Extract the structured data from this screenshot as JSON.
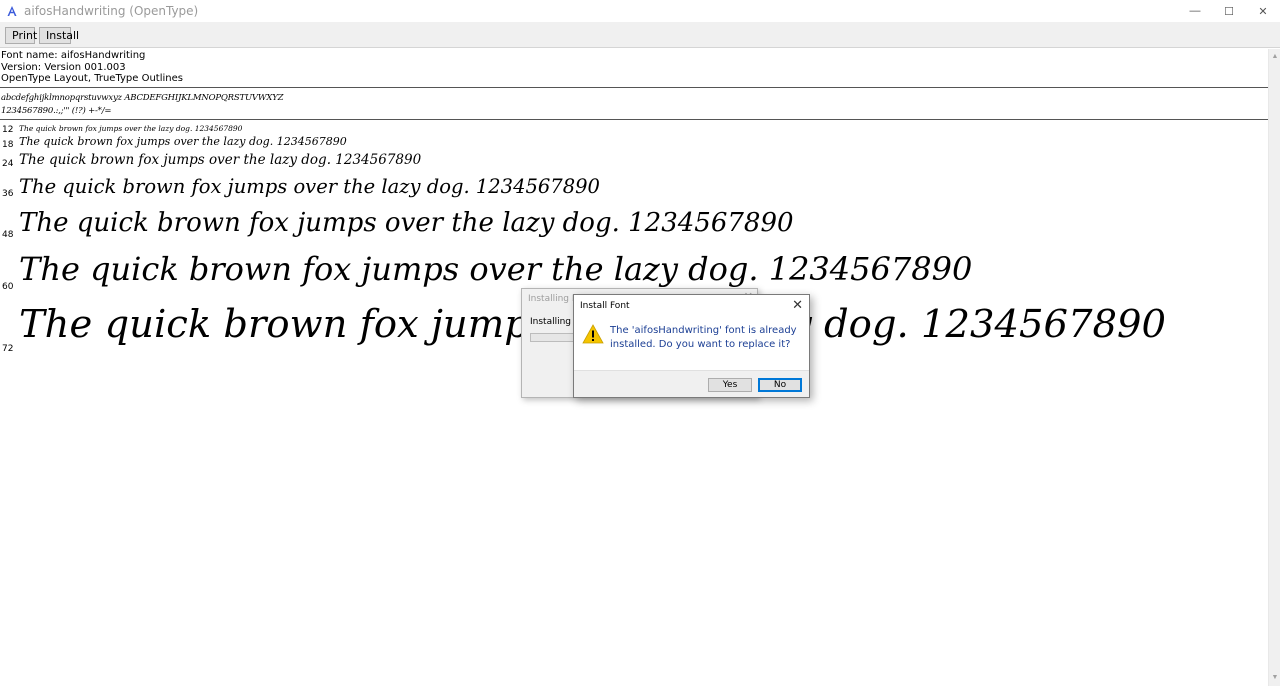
{
  "window": {
    "title": "aifosHandwriting (OpenType)",
    "minimize": "—",
    "maximize": "☐",
    "close": "✕"
  },
  "toolbar": {
    "print_label": "Print",
    "install_label": "Install"
  },
  "font_info": {
    "name": "Font name: aifosHandwriting",
    "version": "Version: Version 001.003",
    "type": "OpenType Layout, TrueType Outlines"
  },
  "charset": {
    "line1": "abcdefghijklmnopqrstuvwxyz ABCDEFGHIJKLMNOPQRSTUVWXYZ",
    "line2": "1234567890.:,;'\" (!?) +-*/="
  },
  "samples": [
    {
      "size": "12",
      "text": "The quick brown fox jumps over the lazy dog. 1234567890"
    },
    {
      "size": "18",
      "text": "The quick brown fox jumps over the lazy dog. 1234567890"
    },
    {
      "size": "24",
      "text": "The quick brown fox jumps over the lazy dog. 1234567890"
    },
    {
      "size": "36",
      "text": "The quick brown fox jumps over the lazy dog. 1234567890"
    },
    {
      "size": "48",
      "text": "The quick brown fox jumps over the lazy dog. 1234567890"
    },
    {
      "size": "60",
      "text": "The quick brown fox jumps over the lazy dog. 1234567890"
    },
    {
      "size": "72",
      "text": "The quick brown fox jumps over the lazy dog. 1234567890"
    }
  ],
  "installing_dialog": {
    "title": "Installing Font",
    "close": "✕",
    "body": "Installing aifosHandwriting"
  },
  "install_dialog": {
    "title": "Install Font",
    "close": "✕",
    "message": "The 'aifosHandwriting' font is already installed. Do you want to replace it?",
    "yes_label": "Yes",
    "no_label": "No"
  },
  "colors": {
    "message_text": "#1c3f94",
    "default_button_border": "#0078d7",
    "warning_yellow": "#f5c400"
  }
}
